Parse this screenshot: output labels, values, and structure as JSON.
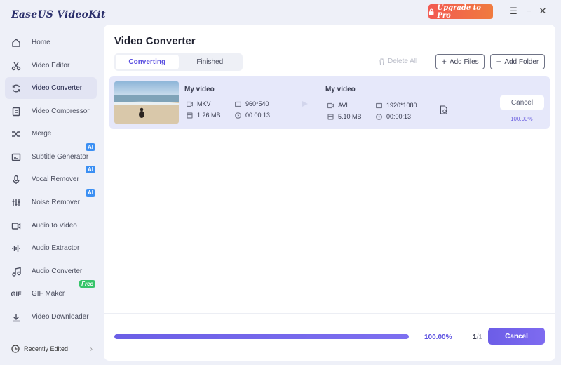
{
  "app": {
    "title": "EaseUS VideoKit",
    "upgrade_label": "Upgrade to Pro"
  },
  "window_controls": {
    "menu": "☰",
    "minimize": "−",
    "close": "✕"
  },
  "sidebar": {
    "items": [
      {
        "label": "Home",
        "icon": "home-icon"
      },
      {
        "label": "Video Editor",
        "icon": "scissors-icon"
      },
      {
        "label": "Video Converter",
        "icon": "convert-icon"
      },
      {
        "label": "Video Compressor",
        "icon": "compress-icon"
      },
      {
        "label": "Merge",
        "icon": "merge-icon"
      },
      {
        "label": "Subtitle Generator",
        "icon": "subtitle-icon",
        "badge": "AI"
      },
      {
        "label": "Vocal Remover",
        "icon": "microphone-icon",
        "badge": "AI"
      },
      {
        "label": "Noise Remover",
        "icon": "sliders-icon",
        "badge": "AI"
      },
      {
        "label": "Audio to Video",
        "icon": "audio-video-icon"
      },
      {
        "label": "Audio Extractor",
        "icon": "waveform-icon"
      },
      {
        "label": "Audio Converter",
        "icon": "music-note-icon"
      },
      {
        "label": "GIF Maker",
        "icon": "gif-icon",
        "badge": "Free"
      },
      {
        "label": "Video Downloader",
        "icon": "download-icon"
      }
    ],
    "active_index": 2,
    "gif_icon_text": "GIF",
    "recently_edited": "Recently Edited"
  },
  "main": {
    "title": "Video Converter",
    "tabs": [
      {
        "label": "Converting"
      },
      {
        "label": "Finished"
      }
    ],
    "active_tab": 0,
    "delete_all": "Delete All",
    "add_files": "Add Files",
    "add_folder": "Add Folder"
  },
  "task": {
    "source": {
      "name": "My video",
      "format": "MKV",
      "resolution": "960*540",
      "size": "1.26 MB",
      "duration": "00:00:13"
    },
    "target": {
      "name": "My video",
      "format": "AVI",
      "resolution": "1920*1080",
      "size": "5.10 MB",
      "duration": "00:00:13"
    },
    "cancel_label": "Cancel",
    "progress_text": "100.00%"
  },
  "footer": {
    "progress_fraction": 1.0,
    "progress_text": "100.00%",
    "page_current": "1",
    "page_total": "/1",
    "cancel_label": "Cancel"
  },
  "colors": {
    "accent": "#6b5fe6",
    "upgrade": "#f25a52"
  }
}
